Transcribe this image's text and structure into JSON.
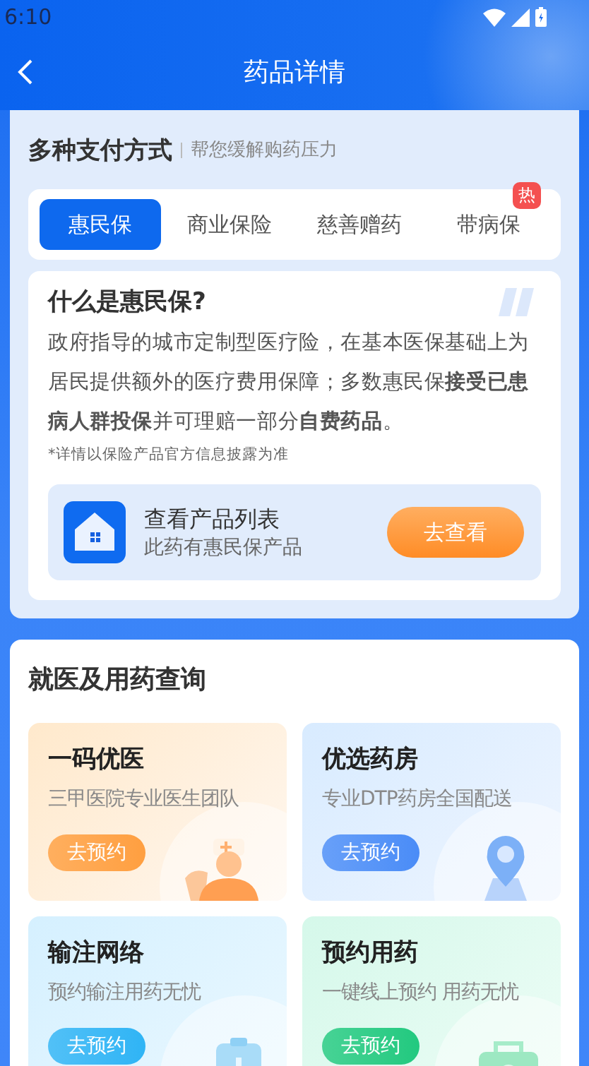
{
  "status_bar": {
    "time": "6:10"
  },
  "header": {
    "title": "药品详情"
  },
  "payment": {
    "title": "多种支付方式",
    "subtitle": "帮您缓解购药压力",
    "tabs": [
      {
        "label": "惠民保",
        "selected": true
      },
      {
        "label": "商业保险",
        "selected": false
      },
      {
        "label": "慈善赠药",
        "selected": false
      },
      {
        "label": "带病保",
        "selected": false,
        "badge": "热"
      }
    ],
    "info": {
      "title": "什么是惠民保?",
      "text": "政府指导的城市定制型医疗险，在基本医保基础上为居民提供额外的医疗费用保障；多数惠民保**接受已患病人群投保**并可理赔一部分**自费药品**。",
      "note": "*详情以保险产品官方信息披露为准"
    },
    "product": {
      "title": "查看产品列表",
      "subtitle": "此药有惠民保产品",
      "button": "去查看"
    }
  },
  "services": {
    "title": "就医及用药查询",
    "tiles": [
      {
        "title": "一码优医",
        "subtitle": "三甲医院专业医生团队",
        "button": "去预约",
        "kind": "doctor",
        "color": "#ff9f40"
      },
      {
        "title": "优选药房",
        "subtitle": "专业DTP药房全国配送",
        "button": "去预约",
        "kind": "pin",
        "color": "#4a8cf7"
      },
      {
        "title": "输注网络",
        "subtitle": "预约输注用药无忧",
        "button": "去预约",
        "kind": "drip",
        "color": "#2fb4f5"
      },
      {
        "title": "预约用药",
        "subtitle": "一键线上预约 用药无忧",
        "button": "去预约",
        "kind": "kit",
        "color": "#22c97f"
      }
    ]
  }
}
